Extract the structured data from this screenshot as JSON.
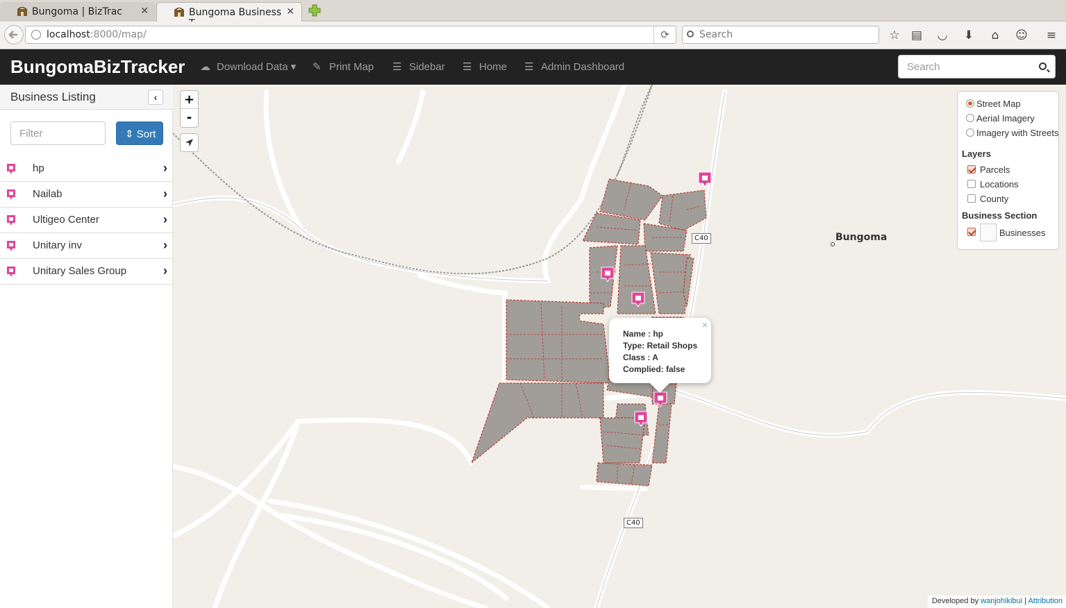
{
  "browser": {
    "tabs": [
      {
        "title": "Bungoma | BizTrac",
        "active": false
      },
      {
        "title": "Bungoma Business T...",
        "active": true
      }
    ],
    "url_host": "localhost",
    "url_rest": ":8000/map/",
    "search_placeholder": "Search"
  },
  "app": {
    "brand": "BungomaBizTracker",
    "nav": {
      "download": "Download Data",
      "print": "Print Map",
      "sidebar": "Sidebar",
      "home": "Home",
      "admin": "Admin Dashboard"
    },
    "search_placeholder": "Search"
  },
  "sidebar": {
    "title": "Business Listing",
    "filter_placeholder": "Filter",
    "sort_label": "Sort",
    "items": [
      {
        "label": "hp"
      },
      {
        "label": "Nailab"
      },
      {
        "label": "Ultigeo Center"
      },
      {
        "label": "Unitary inv"
      },
      {
        "label": "Unitary Sales Group"
      }
    ]
  },
  "map": {
    "zoom_in": "+",
    "zoom_out": "-",
    "place_label": "Bungoma",
    "road_shield_1": "C40",
    "road_shield_2": "C40",
    "basemaps": {
      "street": "Street Map",
      "aerial": "Aerial Imagery",
      "imagery_streets": "Imagery with Streets",
      "selected": "street"
    },
    "layers_heading": "Layers",
    "layers": {
      "parcels": "Parcels",
      "locations": "Locations",
      "county": "County"
    },
    "business_heading": "Business Section",
    "businesses": "Businesses",
    "popup": {
      "name": "Name : hp",
      "type": "Type: Retail Shops",
      "class": "Class : A",
      "complied": "Complied: false",
      "close": "×"
    },
    "attribution": {
      "prefix": "Developed by",
      "author": "wanjohikibui",
      "separator": "|",
      "link": "Attribution"
    }
  },
  "colors": {
    "navbar": "#222222",
    "sort_button": "#337ab7",
    "parcel_fill": "#a19d99",
    "parcel_border": "#c0392b",
    "marker": "#e0469a"
  }
}
